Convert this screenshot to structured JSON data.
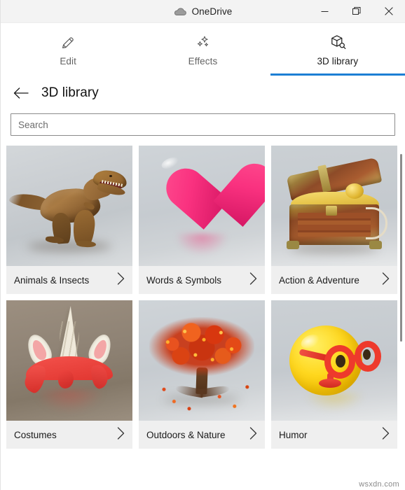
{
  "window": {
    "app_title": "OneDrive",
    "app_icon": "cloud-icon",
    "controls": {
      "minimize": "Minimize",
      "restore": "Restore",
      "close": "Close"
    }
  },
  "tabs": [
    {
      "label": "Edit",
      "icon": "pencil-icon",
      "active": false
    },
    {
      "label": "Effects",
      "icon": "sparkles-icon",
      "active": false
    },
    {
      "label": "3D library",
      "icon": "cube-search-icon",
      "active": true
    }
  ],
  "page": {
    "back_icon": "back-arrow-icon",
    "title": "3D library"
  },
  "search": {
    "placeholder": "Search",
    "value": ""
  },
  "library": {
    "chevron_icon": "chevron-right-icon",
    "cards": [
      {
        "label": "Animals & Insects",
        "thumb": "t-rex-dinosaur"
      },
      {
        "label": "Words & Symbols",
        "thumb": "pink-heart"
      },
      {
        "label": "Action & Adventure",
        "thumb": "treasure-chest"
      },
      {
        "label": "Costumes",
        "thumb": "unicorn-horn-headband"
      },
      {
        "label": "Outdoors & Nature",
        "thumb": "autumn-tree"
      },
      {
        "label": "Humor",
        "thumb": "emoji-with-glasses"
      }
    ]
  },
  "scrollbar": {
    "orientation": "vertical"
  },
  "watermark": "wsxdn.com",
  "colors": {
    "accent": "#1c7fd4",
    "titlebar_bg": "#f3f3f3",
    "card_footer_bg": "#efefef",
    "text_primary": "#1a1a1a",
    "text_secondary": "#636363"
  }
}
